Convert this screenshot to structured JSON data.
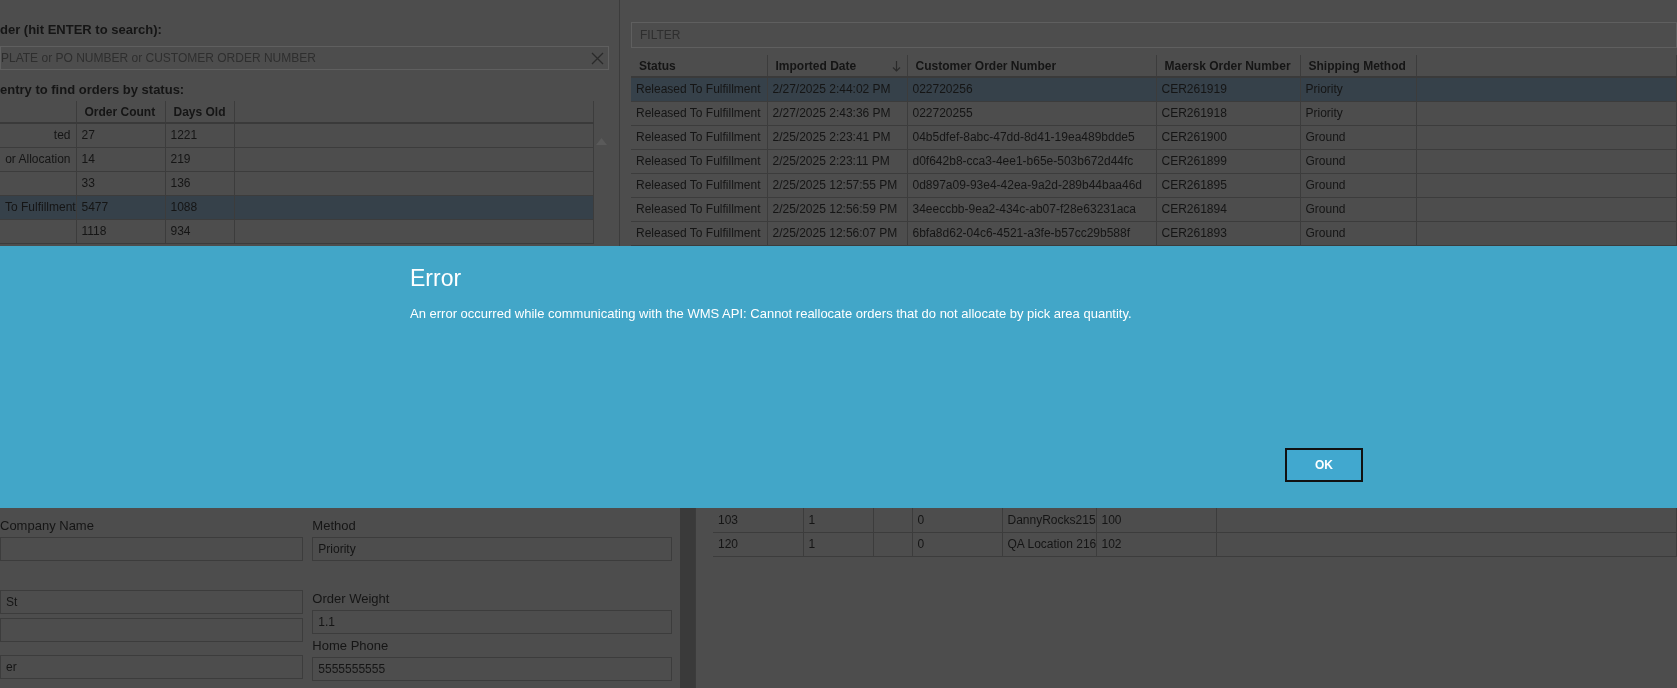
{
  "order_search": {
    "label": "der (hit ENTER to search):",
    "placeholder": "PLATE or PO NUMBER or CUSTOMER ORDER NUMBER"
  },
  "status_summary": {
    "label": "entry to find orders by status:",
    "columns": [
      "Order Count",
      "Days Old"
    ],
    "rows": [
      {
        "status": "ted",
        "order_count": "27",
        "days_old": "1221",
        "selected": false
      },
      {
        "status": "or Allocation",
        "order_count": "14",
        "days_old": "219",
        "selected": false
      },
      {
        "order_count": "33",
        "days_old": "136",
        "selected": false
      },
      {
        "status": "To Fulfillment",
        "order_count": "5477",
        "days_old": "1088",
        "selected": true
      },
      {
        "order_count": "1118",
        "days_old": "934",
        "selected": false
      }
    ]
  },
  "orders": {
    "filter_placeholder": "FILTER",
    "columns": [
      {
        "label": "Status",
        "sorted": false
      },
      {
        "label": "Imported Date",
        "sorted": true
      },
      {
        "label": "Customer Order Number",
        "sorted": false
      },
      {
        "label": "Maersk Order Number",
        "sorted": false
      },
      {
        "label": "Shipping Method",
        "sorted": false
      }
    ],
    "rows": [
      {
        "cells": [
          "Released To Fulfillment",
          "2/27/2025 2:44:02 PM",
          "022720256",
          "CER261919",
          "Priority"
        ],
        "selected": true
      },
      {
        "cells": [
          "Released To Fulfillment",
          "2/27/2025 2:43:36 PM",
          "022720255",
          "CER261918",
          "Priority"
        ],
        "selected": false
      },
      {
        "cells": [
          "Released To Fulfillment",
          "2/25/2025 2:23:41 PM",
          "04b5dfef-8abc-47dd-8d41-19ea489bdde5",
          "CER261900",
          "Ground"
        ],
        "selected": false
      },
      {
        "cells": [
          "Released To Fulfillment",
          "2/25/2025 2:23:11 PM",
          "d0f642b8-cca3-4ee1-b65e-503b672d44fc",
          "CER261899",
          "Ground"
        ],
        "selected": false
      },
      {
        "cells": [
          "Released To Fulfillment",
          "2/25/2025 12:57:55 PM",
          "0d897a09-93e4-42ea-9a2d-289b44baa46d",
          "CER261895",
          "Ground"
        ],
        "selected": false
      },
      {
        "cells": [
          "Released To Fulfillment",
          "2/25/2025 12:56:59 PM",
          "34eeccbb-9ea2-434c-ab07-f28e63231aca",
          "CER261894",
          "Ground"
        ],
        "selected": false
      },
      {
        "cells": [
          "Released To Fulfillment",
          "2/25/2025 12:56:07 PM",
          "6bfa8d62-04c6-4521-a3fe-b57cc29b588f",
          "CER261893",
          "Ground"
        ],
        "selected": false
      }
    ]
  },
  "dialog": {
    "title": "Error",
    "message": "An error occurred while communicating with the WMS API: Cannot reallocate orders that do not allocate by pick area quantity.",
    "buttons": [
      "OK"
    ]
  },
  "order_details": {
    "left": [
      {
        "kind": "label",
        "text": "Company Name"
      },
      {
        "kind": "field"
      },
      {
        "kind": "field",
        "value": "St"
      },
      {
        "kind": "field"
      },
      {
        "kind": "field",
        "value": "er"
      }
    ],
    "right": [
      {
        "kind": "label",
        "text": "Method"
      },
      {
        "kind": "field",
        "value": "Priority"
      },
      {
        "kind": "label",
        "text": "Order Weight"
      },
      {
        "kind": "field",
        "value": "1.1"
      },
      {
        "kind": "label",
        "text": "Home Phone"
      },
      {
        "kind": "field",
        "value": "5555555555"
      }
    ]
  },
  "fulfillment_items": {
    "rows": [
      {
        "column_1": "103",
        "column_2": "1",
        "column_4": "0",
        "column_5": "DannyRocks215",
        "column_6": "100"
      },
      {
        "column_1": "120",
        "column_2": "1",
        "column_4": "0",
        "column_5": "QA Location 216",
        "column_6": "102"
      }
    ]
  }
}
